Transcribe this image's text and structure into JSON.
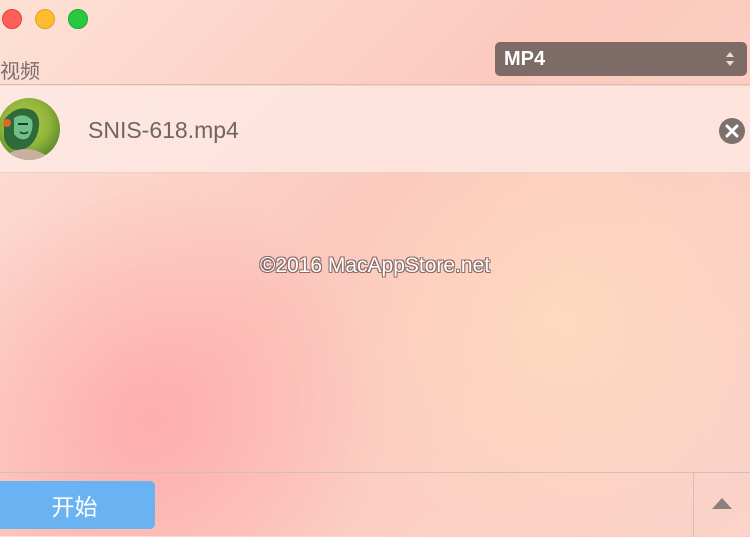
{
  "window": {
    "controls": [
      "close",
      "minimize",
      "zoom"
    ]
  },
  "header": {
    "section_label": "视频",
    "format_select": {
      "value": "MP4",
      "icon": "updown-arrows-icon"
    }
  },
  "files": [
    {
      "name": "SNIS-618.mp4",
      "thumbnail_icon": "video-thumbnail",
      "remove_icon": "remove-circle-icon"
    }
  ],
  "watermark": "©2016 MacAppStore.net",
  "footer": {
    "start_label": "开始",
    "expand_icon": "triangle-up-icon"
  },
  "colors": {
    "start_button": "#69b3f3",
    "select_bg": "#7e6a66",
    "close": "#fe5f57",
    "minimize": "#febc2e",
    "zoom": "#28c840"
  }
}
